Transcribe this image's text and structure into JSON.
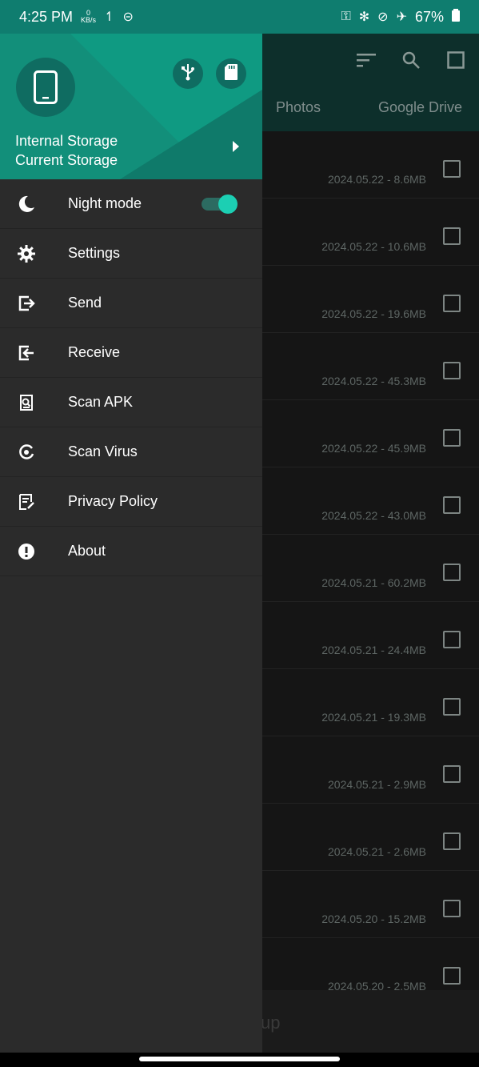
{
  "status_bar": {
    "time": "4:25 PM",
    "net_rate_value": "0",
    "net_rate_unit": "KB/s",
    "battery": "67%"
  },
  "app_background": {
    "tabs": [
      "Photos",
      "Google Drive"
    ],
    "rows": [
      {
        "meta": "2024.05.22 - 8.6MB"
      },
      {
        "meta": "2024.05.22 - 10.6MB"
      },
      {
        "meta": "2024.05.22 - 19.6MB"
      },
      {
        "meta": "2024.05.22 - 45.3MB"
      },
      {
        "meta": "2024.05.22 - 45.9MB"
      },
      {
        "meta": "2024.05.22 - 43.0MB"
      },
      {
        "meta": "2024.05.21 - 60.2MB"
      },
      {
        "meta": "2024.05.21 - 24.4MB"
      },
      {
        "meta": "2024.05.21 - 19.3MB"
      },
      {
        "meta": "2024.05.21 - 2.9MB"
      },
      {
        "meta": "2024.05.21 - 2.6MB"
      },
      {
        "meta": "2024.05.20 - 15.2MB"
      },
      {
        "meta": "2024.05.20 - 2.5MB"
      }
    ],
    "bottom_text": "up"
  },
  "drawer": {
    "storage_name": "Internal Storage",
    "storage_status": "Current Storage",
    "menu": [
      {
        "label": "Night mode",
        "icon": "moon-icon",
        "toggle": true
      },
      {
        "label": "Settings",
        "icon": "gear-icon"
      },
      {
        "label": "Send",
        "icon": "send-icon"
      },
      {
        "label": "Receive",
        "icon": "receive-icon"
      },
      {
        "label": "Scan APK",
        "icon": "scan-apk-icon"
      },
      {
        "label": "Scan Virus",
        "icon": "scan-virus-icon"
      },
      {
        "label": "Privacy Policy",
        "icon": "privacy-policy-icon"
      },
      {
        "label": "About",
        "icon": "info-icon"
      }
    ]
  },
  "colors": {
    "header": "#128f7a",
    "drawer_bg": "#2b2b2b",
    "accent": "#1ccfb3"
  }
}
